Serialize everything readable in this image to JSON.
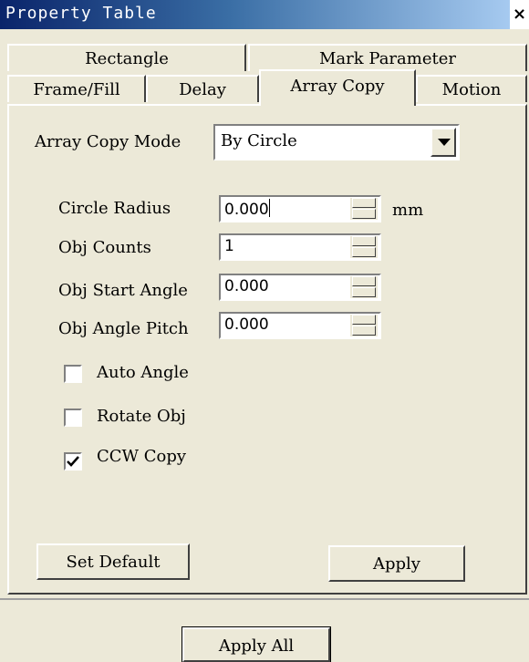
{
  "window": {
    "title": "Property Table",
    "close_glyph": "×"
  },
  "tabs": {
    "row_top": [
      "Rectangle",
      "Mark Parameter"
    ],
    "row_bottom": [
      "Frame/Fill",
      "Delay",
      "Array Copy",
      "Motion"
    ],
    "active": "Array Copy"
  },
  "array_copy": {
    "mode_label": "Array Copy Mode",
    "mode_value": "By Circle",
    "fields": [
      {
        "label": "Circle Radius",
        "value": "0.000",
        "unit": "mm"
      },
      {
        "label": "Obj Counts",
        "value": "1"
      },
      {
        "label": "Obj Start Angle",
        "value": "0.000"
      },
      {
        "label": "Obj Angle Pitch",
        "value": "0.000"
      }
    ],
    "checkboxes": [
      {
        "label": "Auto Angle",
        "checked": false
      },
      {
        "label": "Rotate Obj",
        "checked": false
      },
      {
        "label": "CCW Copy",
        "checked": true
      }
    ],
    "buttons": {
      "set_default": "Set Default",
      "apply": "Apply"
    }
  },
  "footer": {
    "apply_all": "Apply All"
  }
}
